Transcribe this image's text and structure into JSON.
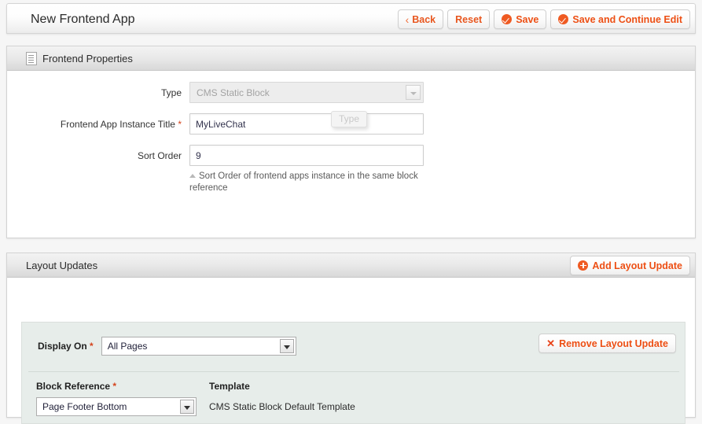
{
  "header": {
    "title": "New Frontend App",
    "buttons": [
      {
        "label": "Back",
        "icon": "chevron-left-icon"
      },
      {
        "label": "Reset",
        "icon": "none"
      },
      {
        "label": "Save",
        "icon": "check-circle-icon"
      },
      {
        "label": "Save and Continue Edit",
        "icon": "check-circle-icon"
      }
    ]
  },
  "properties_panel": {
    "heading": "Frontend Properties",
    "heading_icon": "document-icon",
    "fields": {
      "type": {
        "label": "Type",
        "value": "CMS Static Block",
        "required": false,
        "disabled": true
      },
      "instance_title": {
        "label": "Frontend App Instance Title",
        "required_marker": "*",
        "value": "MyLiveChat",
        "placeholder": ""
      },
      "sort_order": {
        "label": "Sort Order",
        "value": "9",
        "placeholder": "",
        "hint": "Sort Order of frontend apps instance in the same block reference"
      }
    },
    "tooltip": "Type"
  },
  "layout_panel": {
    "heading": "Layout Updates",
    "add_button": {
      "label": "Add Layout Update",
      "icon": "plus-circle-icon"
    },
    "update": {
      "display_on": {
        "label": "Display On",
        "required_marker": "*",
        "value": "All Pages"
      },
      "remove_button": {
        "label": "Remove Layout Update",
        "icon": "x-icon"
      },
      "block_reference": {
        "label": "Block Reference",
        "required_marker": "*",
        "value": "Page Footer Bottom"
      },
      "template": {
        "label": "Template",
        "value": "CMS Static Block Default Template"
      }
    }
  },
  "colors": {
    "accent": "#ef5a22",
    "link": "#ed4f14",
    "required": "#d4431c",
    "panel_bg": "#ffffff",
    "inner_box_bg": "#e7edea",
    "page_bg": "#f6f6f6"
  }
}
